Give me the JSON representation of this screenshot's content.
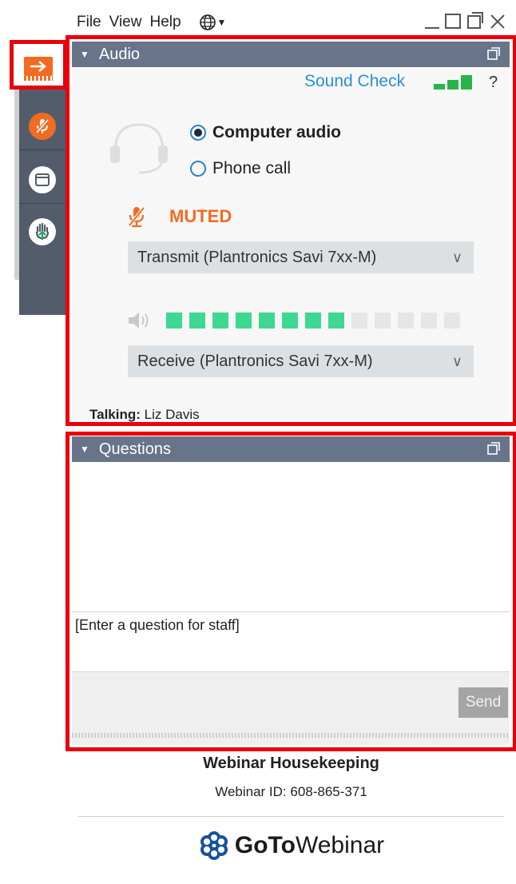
{
  "menu": {
    "items": [
      "File",
      "View",
      "Help"
    ]
  },
  "audio": {
    "header": "Audio",
    "sound_check": "Sound Check",
    "help": "?",
    "options": [
      "Computer audio",
      "Phone call"
    ],
    "selected_option": "Computer audio",
    "mute_status": "MUTED",
    "transmit_device": "Transmit (Plantronics Savi 7xx-M)",
    "receive_device": "Receive (Plantronics Savi 7xx-M)",
    "speaker_level_filled": 8,
    "speaker_level_total": 13,
    "talking_label": "Talking:",
    "talking_name": "Liz Davis",
    "signal_bars": 3
  },
  "questions": {
    "header": "Questions",
    "input_placeholder": "[Enter a question for staff]",
    "send_label": "Send"
  },
  "footer": {
    "title": "Webinar Housekeeping",
    "webinar_id": "Webinar ID: 608-865-371",
    "brand_bold": "GoTo",
    "brand_light": "Webinar"
  },
  "colors": {
    "accent_orange": "#f26b22",
    "highlight_red": "#e8000b",
    "meter_green": "#3ed893",
    "header_slate": "#67748a"
  }
}
